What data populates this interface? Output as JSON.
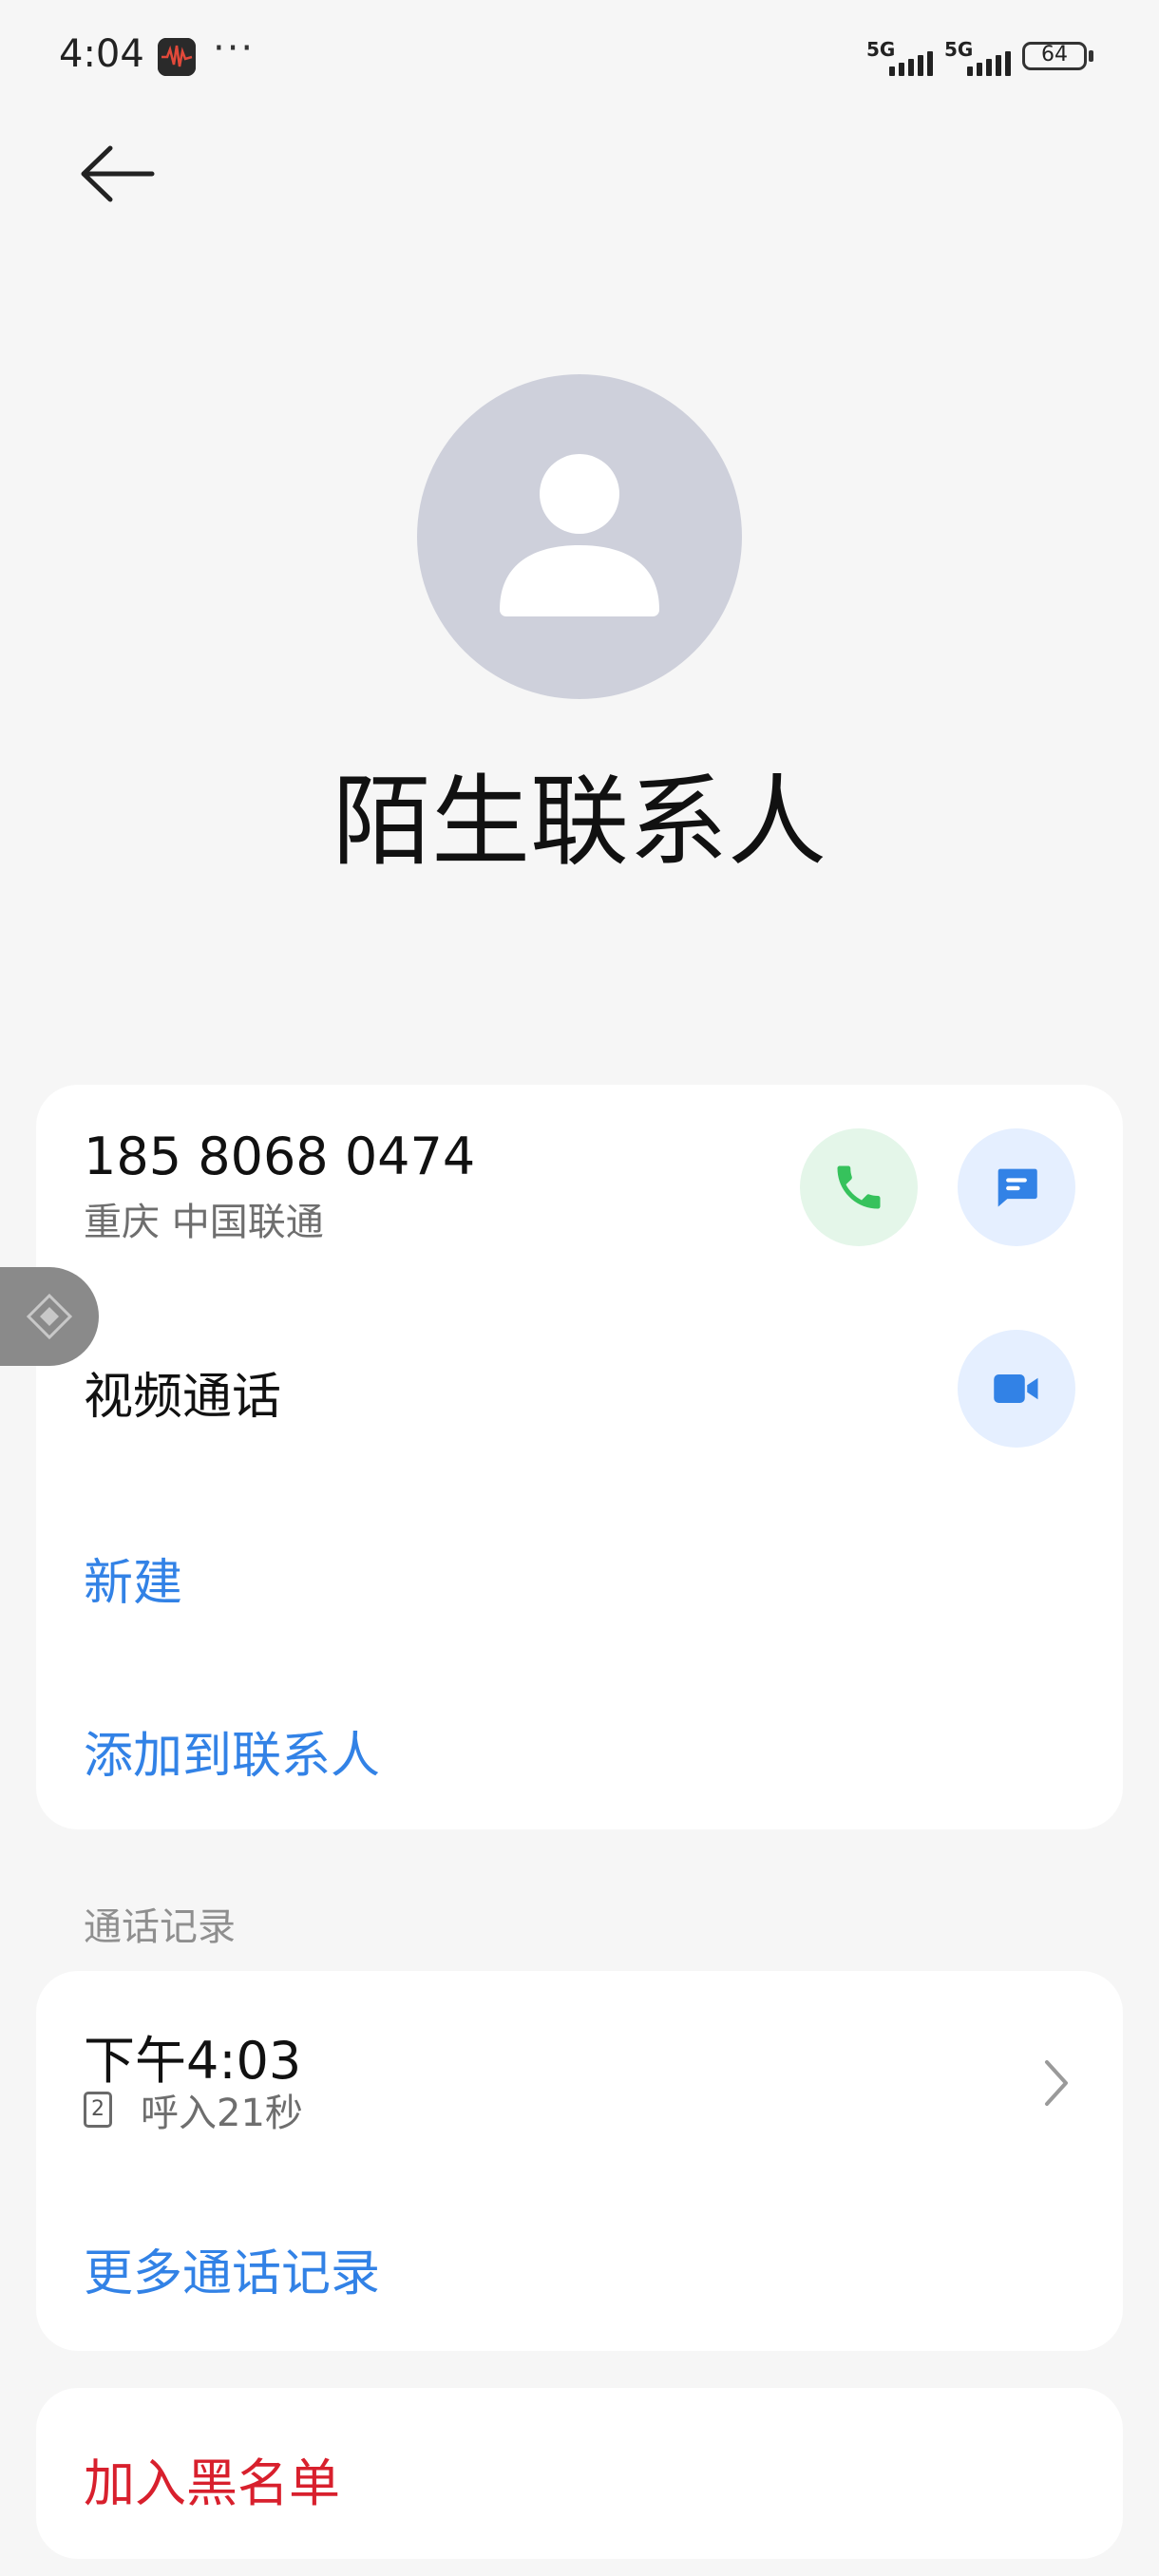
{
  "status_bar": {
    "time": "4:04",
    "more": "···",
    "signal1_label": "5G",
    "signal2_label": "5G",
    "battery_level": "64"
  },
  "icons": {
    "back": "arrow-left-icon",
    "avatar": "person-icon",
    "call": "phone-icon",
    "message": "message-icon",
    "video": "video-camera-icon",
    "chevron": "chevron-right-icon",
    "sim": "sim-2-icon",
    "float": "floating-assist-icon"
  },
  "contact": {
    "name": "陌生联系人",
    "phone": "185 8068 0474",
    "location": "重庆 中国联通"
  },
  "actions": {
    "video_call": "视频通话",
    "new": "新建",
    "add_to_contacts": "添加到联系人"
  },
  "call_log": {
    "section_title": "通话记录",
    "entry": {
      "time": "下午4:03",
      "sim": "2",
      "detail": "呼入21秒"
    },
    "more": "更多通话记录"
  },
  "blacklist": {
    "label": "加入黑名单"
  },
  "colors": {
    "background": "#f6f6f6",
    "accent_blue": "#3282e6",
    "danger_red": "#d8202d",
    "call_green": "#36c25c",
    "avatar_gray": "#ced0db"
  }
}
